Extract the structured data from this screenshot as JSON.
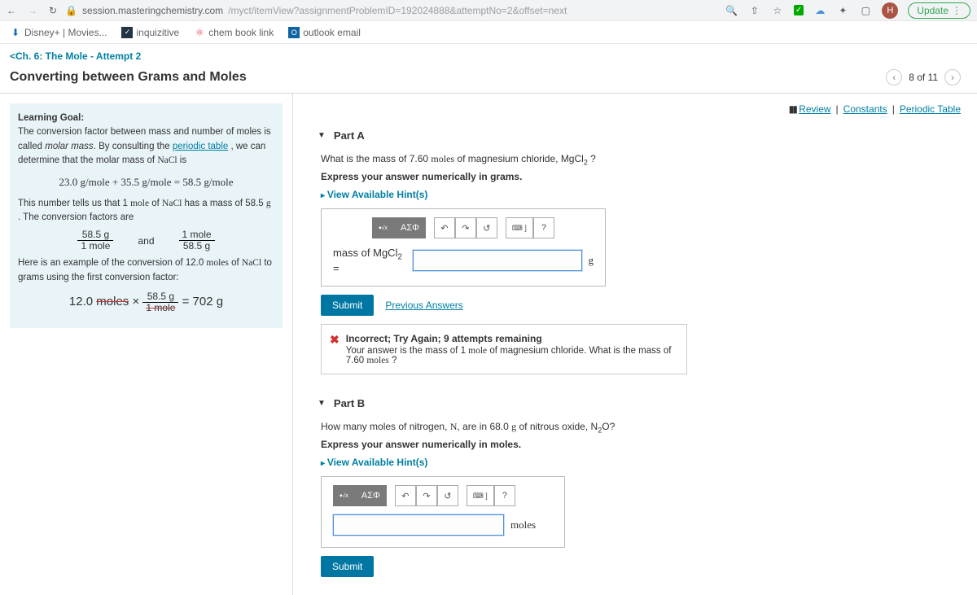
{
  "browser": {
    "url_host": "session.masteringchemistry.com",
    "url_path": "/myct/itemView?assignmentProblemID=192024888&attemptNo=2&offset=next",
    "avatar": "H",
    "update": "Update"
  },
  "bookmarks": {
    "disney": "Disney+ | Movies...",
    "inquizitive": "inquizitive",
    "chem": "chem book link",
    "outlook": "outlook email"
  },
  "header": {
    "breadcrumb": "Ch. 6: The Mole - Attempt 2",
    "title": "Converting between Grams and Moles",
    "pager": "8 of 11"
  },
  "tools": {
    "review": "Review",
    "constants": "Constants",
    "periodic": "Periodic Table"
  },
  "learning": {
    "heading": "Learning Goal:",
    "p1a": "The conversion factor between mass and number of moles is called ",
    "p1b": "molar mass",
    "p1c": ". By consulting the ",
    "p1link": "periodic table",
    "p1d": " , we can determine that the molar mass of ",
    "p1e": "NaCl",
    "p1f": " is",
    "eq1": "23.0 g/mole + 35.5 g/mole = 58.5 g/mole",
    "p2a": "This number tells us that 1 ",
    "p2b": "mole",
    "p2c": " of ",
    "p2d": "NaCl",
    "p2e": " has a mass of 58.5 ",
    "p2f": "g",
    "p2g": " . The conversion factors are",
    "frac1n": "58.5 g",
    "frac1d": "1 mole",
    "and": "and",
    "frac2n": "1 mole",
    "frac2d": "58.5 g",
    "p3a": "Here is an example of the conversion of 12.0 ",
    "p3b": "moles",
    "p3c": " of ",
    "p3d": "NaCl",
    "p3e": " to grams using the first conversion factor:",
    "eq2_a": "12.0 ",
    "eq2_b": "moles",
    "eq2_c": " × ",
    "eq2_fn": "58.5 g",
    "eq2_fd": "1 mole",
    "eq2_d": " = 702 g"
  },
  "partA": {
    "label": "Part A",
    "q_a": "What is the mass of 7.60 ",
    "q_b": "moles",
    "q_c": " of magnesium chloride, ",
    "q_d": "MgCl",
    "q_e": " ?",
    "instruct": "Express your answer numerically in grams.",
    "hints": "View Available Hint(s)",
    "lhs_a": "mass of ",
    "lhs_b": "MgCl",
    "lhs_c": " =",
    "unit": "g",
    "submit": "Submit",
    "prev": "Previous Answers",
    "fb_title": "Incorrect; Try Again; 9 attempts remaining",
    "fb_a": "Your answer is the mass of 1 ",
    "fb_b": "mole",
    "fb_c": " of magnesium chloride. What is the mass of 7.60 ",
    "fb_d": "moles",
    "fb_e": " ?"
  },
  "partB": {
    "label": "Part B",
    "q_a": "How many moles of nitrogen, ",
    "q_b": "N",
    "q_c": ", are in 68.0 ",
    "q_d": "g",
    "q_e": " of nitrous oxide, ",
    "q_f": "N",
    "q_g": "O",
    "q_h": "?",
    "instruct": "Express your answer numerically in moles.",
    "hints": "View Available Hint(s)",
    "unit": "moles",
    "submit": "Submit"
  },
  "toolbar": {
    "greek": "ΑΣΦ"
  }
}
